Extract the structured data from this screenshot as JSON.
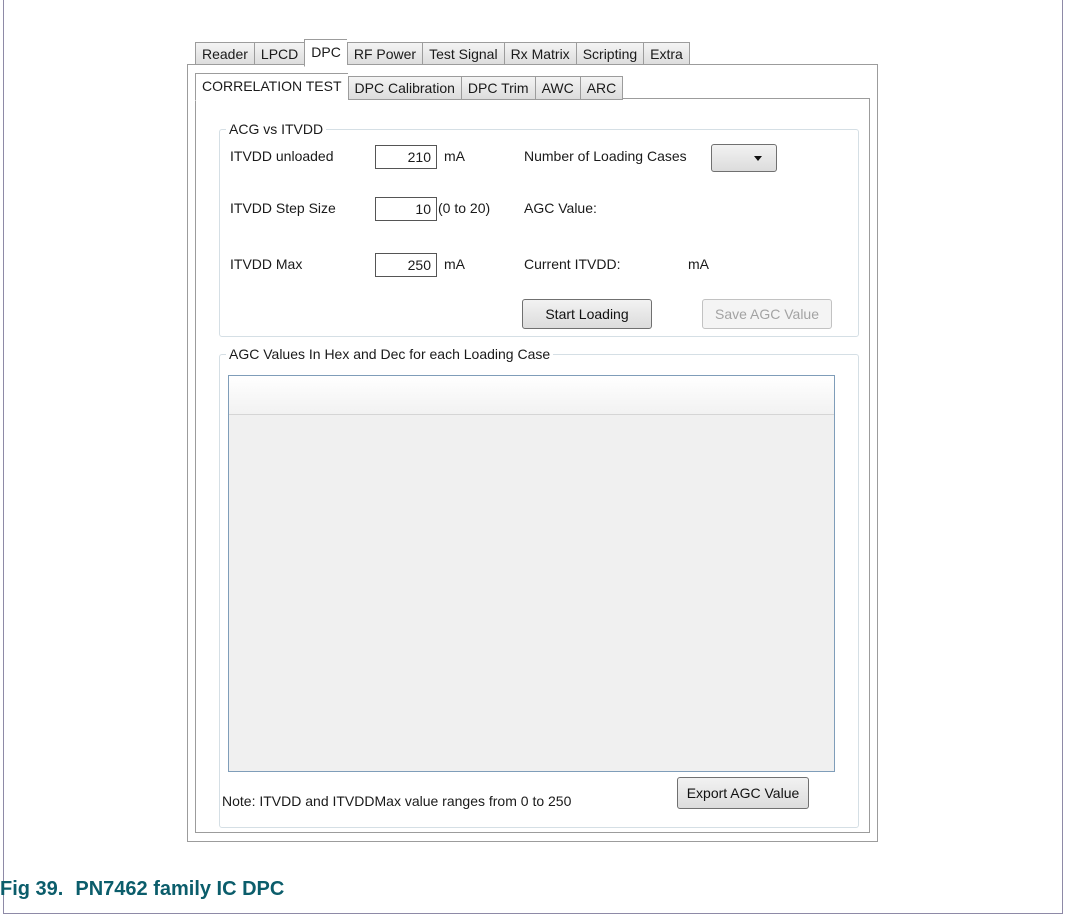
{
  "top_tabs": [
    "Reader",
    "LPCD",
    "DPC",
    "RF Power",
    "Test Signal",
    "Rx Matrix",
    "Scripting",
    "Extra"
  ],
  "sub_tabs": [
    "CORRELATION TEST",
    "DPC Calibration",
    "DPC Trim",
    "AWC",
    "ARC"
  ],
  "acg_group": {
    "title": "ACG vs ITVDD",
    "itvdd_unloaded_label": "ITVDD unloaded",
    "itvdd_unloaded_value": "210",
    "itvdd_unloaded_unit": "mA",
    "step_size_label": "ITVDD Step Size",
    "step_size_value": "10",
    "step_size_range": "(0 to 20)",
    "itvdd_max_label": "ITVDD Max",
    "itvdd_max_value": "250",
    "itvdd_max_unit": "mA",
    "loading_cases_label": "Number of Loading Cases",
    "loading_cases_value": "",
    "agc_value_label": "AGC Value:",
    "current_itvdd_label": "Current ITVDD:",
    "current_itvdd_unit": "mA",
    "start_loading_button": "Start Loading",
    "save_agc_button": "Save AGC Value"
  },
  "agc_values_group": {
    "title": "AGC Values In Hex and Dec for each Loading Case",
    "note": "Note: ITVDD and ITVDDMax value ranges from 0 to 250",
    "export_button": "Export AGC Value"
  },
  "caption": {
    "fig_number": "Fig 39.",
    "text": "PN7462 family IC DPC"
  }
}
